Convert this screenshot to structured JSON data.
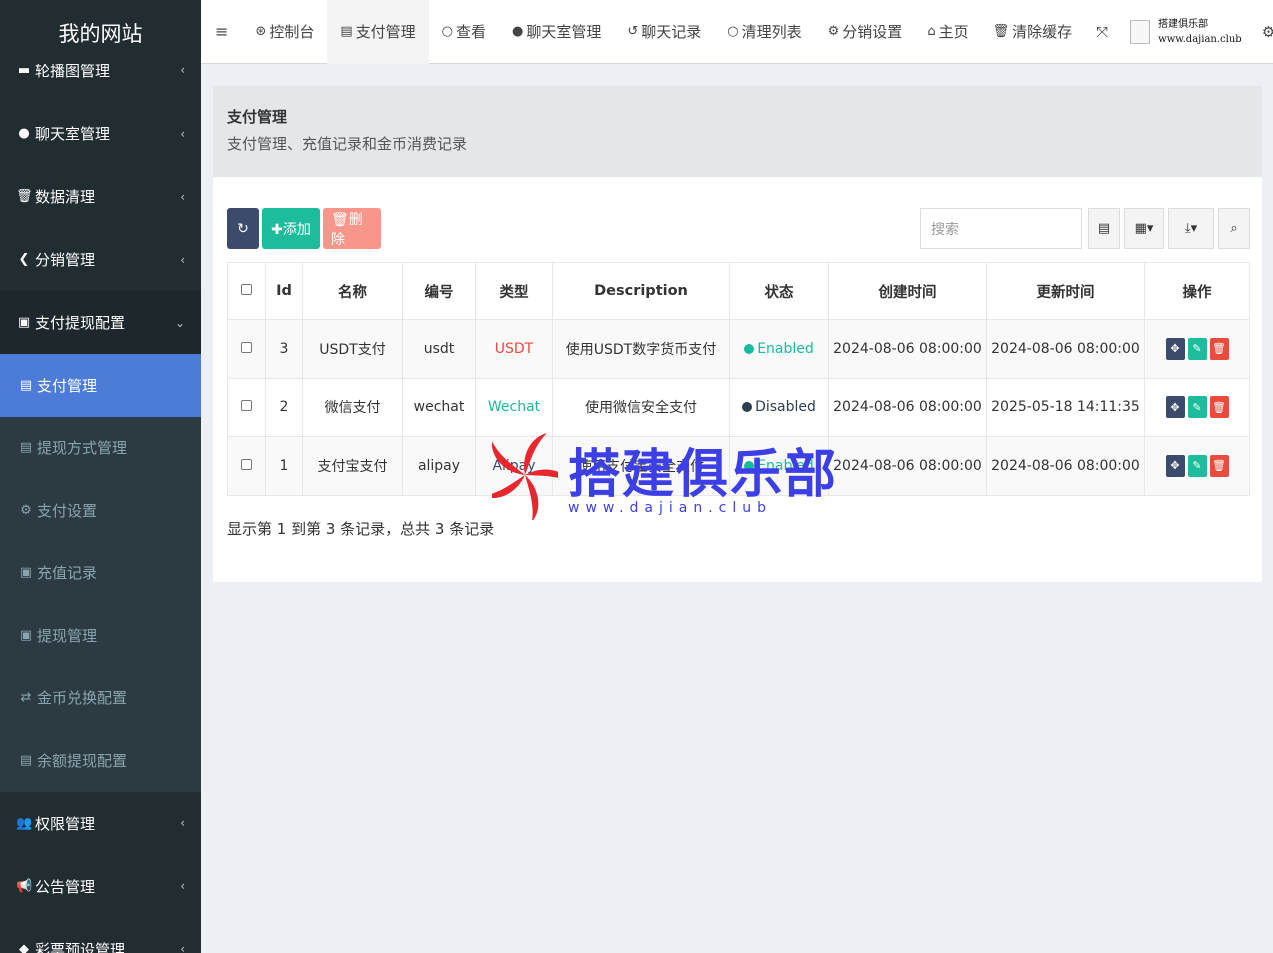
{
  "sidebar": {
    "logo": "我的网站",
    "items": [
      {
        "label": "轮播图管理",
        "icon": "image-icon",
        "glyph": "▬",
        "caret": "‹"
      },
      {
        "label": "聊天室管理",
        "icon": "comment-icon",
        "glyph": "●",
        "caret": "‹"
      },
      {
        "label": "数据清理",
        "icon": "trash-icon",
        "glyph": "🗑",
        "caret": "‹"
      },
      {
        "label": "分销管理",
        "icon": "share-icon",
        "glyph": "❮",
        "caret": "‹"
      },
      {
        "label": "支付提现配置",
        "icon": "money-icon",
        "glyph": "▣",
        "caret": "⌄"
      },
      {
        "label": "支付管理",
        "icon": "credit-card-icon",
        "glyph": "▤"
      },
      {
        "label": "提现方式管理",
        "icon": "credit-card-icon",
        "glyph": "▤"
      },
      {
        "label": "支付设置",
        "icon": "gear-icon",
        "glyph": "⚙"
      },
      {
        "label": "充值记录",
        "icon": "money-icon",
        "glyph": "▣"
      },
      {
        "label": "提现管理",
        "icon": "money-icon",
        "glyph": "▣"
      },
      {
        "label": "金币兑换配置",
        "icon": "exchange-icon",
        "glyph": "⇄"
      },
      {
        "label": "余额提现配置",
        "icon": "credit-card-icon",
        "glyph": "▤"
      },
      {
        "label": "权限管理",
        "icon": "users-icon",
        "glyph": "👥",
        "caret": "‹"
      },
      {
        "label": "公告管理",
        "icon": "bullhorn-icon",
        "glyph": "📢",
        "caret": "‹"
      },
      {
        "label": "彩票预设管理",
        "icon": "tag-icon",
        "glyph": "◆",
        "caret": "‹"
      }
    ]
  },
  "topbar": {
    "menu_glyph": "≡",
    "tabs": [
      {
        "label": "控制台",
        "glyph": "⊛"
      },
      {
        "label": "支付管理",
        "glyph": "▤"
      },
      {
        "label": "查看",
        "glyph": "○"
      },
      {
        "label": "聊天室管理",
        "glyph": "●"
      },
      {
        "label": "聊天记录",
        "glyph": "↺"
      },
      {
        "label": "清理列表",
        "glyph": "○"
      },
      {
        "label": "分销设置",
        "glyph": "⚙"
      }
    ],
    "home": "主页",
    "home_glyph": "⌂",
    "clear_cache": "清除缓存",
    "clear_glyph": "🗑",
    "fullscreen_glyph": "⤧",
    "user_line1": "搭建俱乐部",
    "user_line2": "www.dajian.club",
    "settings_glyph": "⚙"
  },
  "header": {
    "title": "支付管理",
    "subtitle": "支付管理、充值记录和金币消费记录"
  },
  "toolbar": {
    "refresh_glyph": "↻",
    "add_label": "✚添加",
    "delete_label": "🗑删除",
    "search_placeholder": "搜索",
    "view_glyph": "▤",
    "columns_glyph": "▦▾",
    "export_glyph": "⤓▾",
    "search_glyph": "⌕"
  },
  "table": {
    "columns": [
      "Id",
      "名称",
      "编号",
      "类型",
      "Description",
      "状态",
      "创建时间",
      "更新时间",
      "操作"
    ],
    "rows": [
      {
        "id": "3",
        "name": "USDT支付",
        "code": "usdt",
        "type": "USDT",
        "type_color": "#e74c3c",
        "desc": "使用USDT数字货币支付",
        "status": "Enabled",
        "status_color": "#18bc9c",
        "created": "2024-08-06 08:00:00",
        "updated": "2024-08-06 08:00:00"
      },
      {
        "id": "2",
        "name": "微信支付",
        "code": "wechat",
        "type": "Wechat",
        "type_color": "#18bc9c",
        "desc": "使用微信安全支付",
        "status": "Disabled",
        "status_color": "#2c3e50",
        "created": "2024-08-06 08:00:00",
        "updated": "2025-05-18 14:11:35"
      },
      {
        "id": "1",
        "name": "支付宝支付",
        "code": "alipay",
        "type": "Alipay",
        "type_color": "#3c4b6b",
        "desc": "使用支付宝安全支付",
        "status": "Enabled",
        "status_color": "#18bc9c",
        "created": "2024-08-06 08:00:00",
        "updated": "2024-08-06 08:00:00"
      }
    ],
    "op_glyphs": {
      "move": "✥",
      "edit": "✎",
      "delete": "🗑"
    }
  },
  "pager": "显示第 1 到第 3 条记录，总共 3 条记录",
  "watermark": {
    "text": "搭建俱乐部",
    "url": "www.dajian.club"
  }
}
